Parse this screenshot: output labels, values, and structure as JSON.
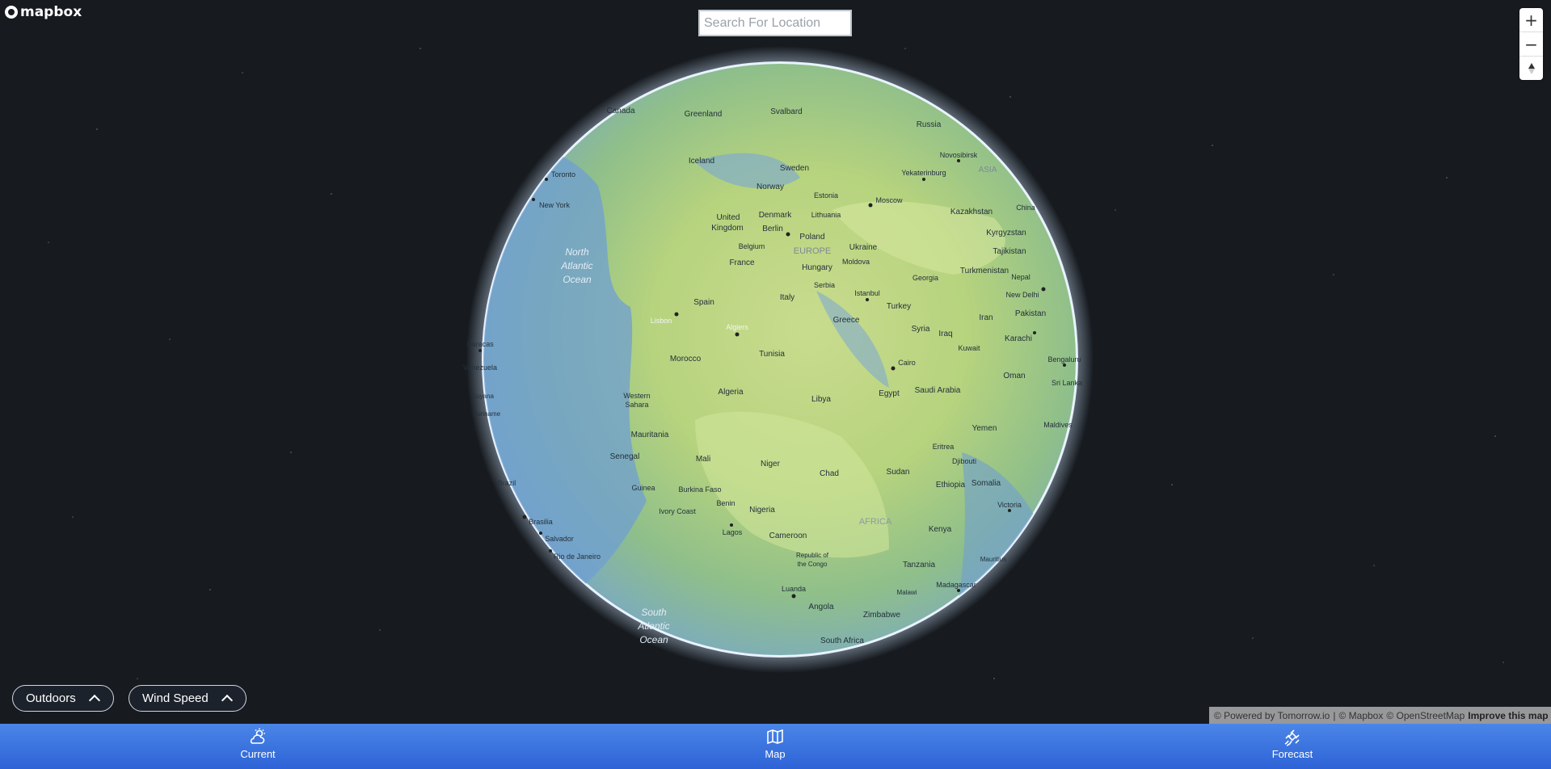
{
  "brand": {
    "logo_text": "mapbox",
    "icon": "mapbox-logo-icon"
  },
  "search": {
    "placeholder": "Search For Location",
    "value": ""
  },
  "map_controls": {
    "zoom_in": "+",
    "zoom_out": "−",
    "compass_icon": "compass-icon"
  },
  "globe_labels": [
    {
      "text": "Canada"
    },
    {
      "text": "Greenland"
    },
    {
      "text": "Svalbard"
    },
    {
      "text": "Russia"
    },
    {
      "text": "Iceland"
    },
    {
      "text": "Sweden"
    },
    {
      "text": "Novosibirsk"
    },
    {
      "text": "ASIA"
    },
    {
      "text": "Yekaterinburg"
    },
    {
      "text": "Toronto"
    },
    {
      "text": "Norway"
    },
    {
      "text": "Estonia"
    },
    {
      "text": "Moscow"
    },
    {
      "text": "New York"
    },
    {
      "text": "Lithuania"
    },
    {
      "text": "Kazakhstan"
    },
    {
      "text": "China"
    },
    {
      "text": "United"
    },
    {
      "text": "Kingdom"
    },
    {
      "text": "Denmark"
    },
    {
      "text": "Berlin"
    },
    {
      "text": "Poland"
    },
    {
      "text": "Kyrgyzstan"
    },
    {
      "text": "Belgium"
    },
    {
      "text": "Ukraine"
    },
    {
      "text": "Tajikistan"
    },
    {
      "text": "North"
    },
    {
      "text": "Atlantic"
    },
    {
      "text": "Ocean"
    },
    {
      "text": "France"
    },
    {
      "text": "EUROPE"
    },
    {
      "text": "Moldova"
    },
    {
      "text": "Hungary"
    },
    {
      "text": "Turkmenistan"
    },
    {
      "text": "Georgia"
    },
    {
      "text": "Nepal"
    },
    {
      "text": "Serbia"
    },
    {
      "text": "Spain"
    },
    {
      "text": "Italy"
    },
    {
      "text": "Istanbul"
    },
    {
      "text": "New Delhi"
    },
    {
      "text": "Turkey"
    },
    {
      "text": "Pakistan"
    },
    {
      "text": "Lisbon"
    },
    {
      "text": "Greece"
    },
    {
      "text": "Iran"
    },
    {
      "text": "Algiers"
    },
    {
      "text": "Syria"
    },
    {
      "text": "Iraq"
    },
    {
      "text": "Karachi"
    },
    {
      "text": "Caracas"
    },
    {
      "text": "Kuwait"
    },
    {
      "text": "Tunisia"
    },
    {
      "text": "Bengaluru"
    },
    {
      "text": "Cairo"
    },
    {
      "text": "Venezuela"
    },
    {
      "text": "Morocco"
    },
    {
      "text": "Oman"
    },
    {
      "text": "Sri Lanka"
    },
    {
      "text": "Saudi Arabia"
    },
    {
      "text": "Algeria"
    },
    {
      "text": "Egypt"
    },
    {
      "text": "Guyana"
    },
    {
      "text": "Western"
    },
    {
      "text": "Sahara"
    },
    {
      "text": "Libya"
    },
    {
      "text": "Suriname"
    },
    {
      "text": "Maldives"
    },
    {
      "text": "Yemen"
    },
    {
      "text": "Mauritania"
    },
    {
      "text": "Eritrea"
    },
    {
      "text": "Senegal"
    },
    {
      "text": "Mali"
    },
    {
      "text": "Djibouti"
    },
    {
      "text": "Niger"
    },
    {
      "text": "Chad"
    },
    {
      "text": "Sudan"
    },
    {
      "text": "Brazil"
    },
    {
      "text": "Ethiopia"
    },
    {
      "text": "Somalia"
    },
    {
      "text": "Guinea"
    },
    {
      "text": "Burkina Faso"
    },
    {
      "text": "Benin"
    },
    {
      "text": "Victoria"
    },
    {
      "text": "Ivory Coast"
    },
    {
      "text": "Nigeria"
    },
    {
      "text": "AFRICA"
    },
    {
      "text": "Brasilia"
    },
    {
      "text": "Lagos"
    },
    {
      "text": "Cameroon"
    },
    {
      "text": "Kenya"
    },
    {
      "text": "Salvador"
    },
    {
      "text": "Republic of"
    },
    {
      "text": "the Congo"
    },
    {
      "text": "Rio de Janeiro"
    },
    {
      "text": "Mauritius"
    },
    {
      "text": "Tanzania"
    },
    {
      "text": "Luanda"
    },
    {
      "text": "Madagascar"
    },
    {
      "text": "Malawi"
    },
    {
      "text": "Angola"
    },
    {
      "text": "Zimbabwe"
    },
    {
      "text": "South"
    },
    {
      "text": "Atlantic"
    },
    {
      "text": "Ocean"
    },
    {
      "text": "South Africa"
    }
  ],
  "bottom_controls": {
    "style_select": "Outdoors",
    "layer_select": "Wind Speed"
  },
  "attribution": {
    "powered_by": "© Powered by Tomorrow.io",
    "mapbox": "© Mapbox",
    "osm": "© OpenStreetMap",
    "improve": "Improve this map"
  },
  "nav": {
    "items": [
      {
        "label": "Current",
        "icon": "weather-cloud-sun-icon"
      },
      {
        "label": "Map",
        "icon": "map-icon"
      },
      {
        "label": "Forecast",
        "icon": "satellite-icon"
      }
    ]
  }
}
